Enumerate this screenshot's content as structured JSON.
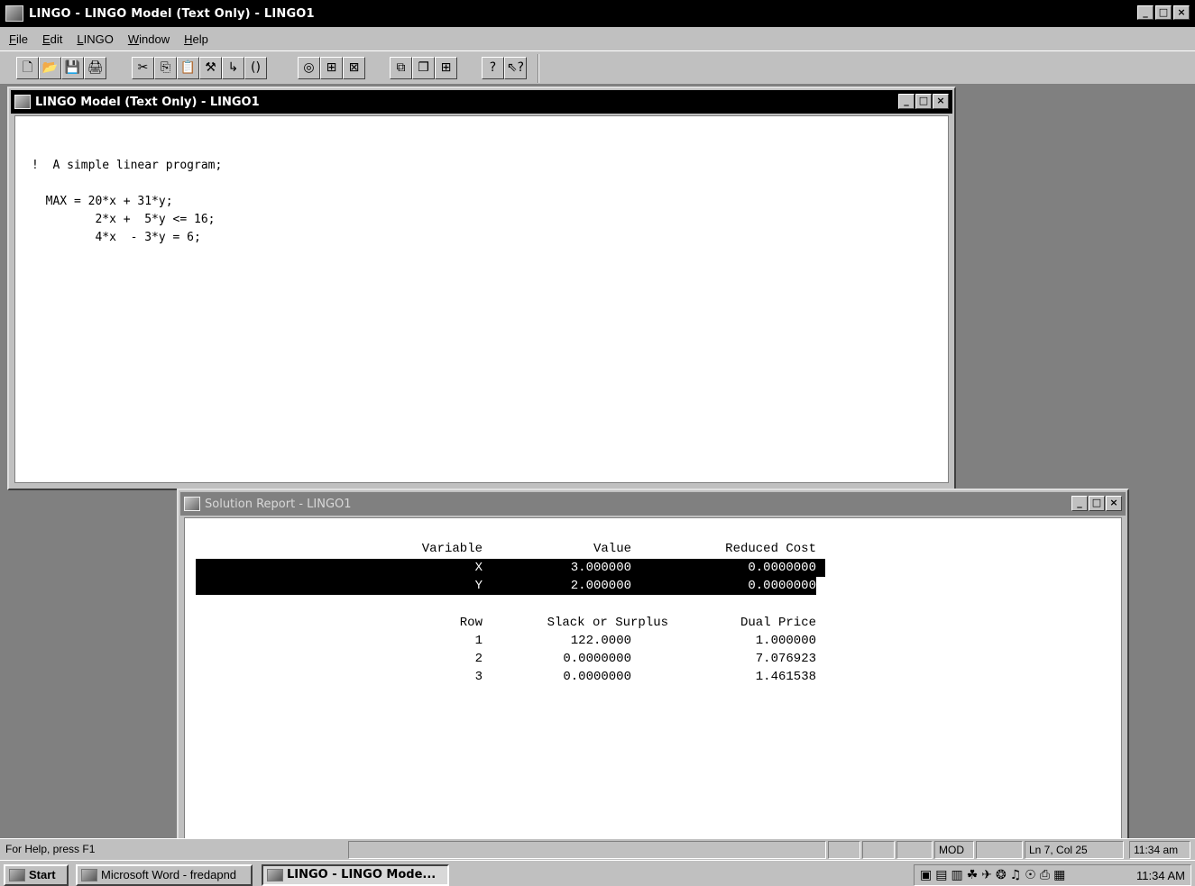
{
  "app": {
    "title": "LINGO - LINGO Model (Text Only) - LINGO1",
    "window_buttons": {
      "minimize": "_",
      "restore": "□",
      "close": "×"
    }
  },
  "menu": [
    "File",
    "Edit",
    "LINGO",
    "Window",
    "Help"
  ],
  "toolbar": {
    "group1": [
      {
        "name": "new-icon",
        "glyph": "🗋"
      },
      {
        "name": "open-icon",
        "glyph": "📂"
      },
      {
        "name": "save-icon",
        "glyph": "💾"
      },
      {
        "name": "print-icon",
        "glyph": "🖨"
      }
    ],
    "group2": [
      {
        "name": "cut-icon",
        "glyph": "✂"
      },
      {
        "name": "copy-icon",
        "glyph": "⎘"
      },
      {
        "name": "paste-icon",
        "glyph": "📋"
      },
      {
        "name": "find-icon",
        "glyph": "⚒"
      },
      {
        "name": "goto-line-icon",
        "glyph": "↳"
      },
      {
        "name": "match-parenthesis-icon",
        "glyph": "()"
      }
    ],
    "group3": [
      {
        "name": "solve-icon",
        "glyph": "◎"
      },
      {
        "name": "solution-icon",
        "glyph": "⊞"
      },
      {
        "name": "close-all-icon",
        "glyph": "⊠"
      }
    ],
    "group4": [
      {
        "name": "send-to-back-icon",
        "glyph": "⧉"
      },
      {
        "name": "cascade-icon",
        "glyph": "❐"
      },
      {
        "name": "tile-icon",
        "glyph": "⊞"
      }
    ],
    "group5": [
      {
        "name": "help-icon",
        "glyph": "?"
      },
      {
        "name": "context-help-icon",
        "glyph": "⇖?"
      }
    ]
  },
  "model_window": {
    "title": "LINGO Model (Text Only) - LINGO1",
    "code": "!  A simple linear program;\n\n  MAX = 20*x + 31*y;\n         2*x +  5*y <= 16;\n         4*x  - 3*y = 6;"
  },
  "report_window": {
    "title": "Solution Report - LINGO1",
    "var_headers": {
      "variable": "Variable",
      "value": "Value",
      "reduced_cost": "Reduced Cost"
    },
    "variables": [
      {
        "variable": "X",
        "value": "3.000000",
        "reduced_cost": "0.0000000"
      },
      {
        "variable": "Y",
        "value": "2.000000",
        "reduced_cost": "0.0000000"
      }
    ],
    "row_headers": {
      "row": "Row",
      "slack": "Slack or Surplus",
      "dual": "Dual Price"
    },
    "rows": [
      {
        "row": "1",
        "slack": "122.0000",
        "dual": "1.000000"
      },
      {
        "row": "2",
        "slack": "0.0000000",
        "dual": "7.076923"
      },
      {
        "row": "3",
        "slack": "0.0000000",
        "dual": "1.461538"
      }
    ]
  },
  "statusbar": {
    "help": "For Help, press F1",
    "mod": "MOD",
    "position": "Ln 7, Col 25",
    "time": "11:34 am"
  },
  "taskbar": {
    "start": "Start",
    "tasks": [
      "Microsoft Word - fredapnd",
      "LINGO - LINGO Mode..."
    ],
    "clock": "11:34 AM",
    "tray_icons": [
      "▣",
      "▤",
      "▥",
      "☘",
      "✈",
      "❂",
      "♫",
      "☉",
      "⎙",
      "▦"
    ]
  },
  "colors": {
    "desktop": "#808080",
    "face": "#c0c0c0",
    "active_title": "#000000",
    "inactive_title": "#808080",
    "highlight": "#000000"
  }
}
